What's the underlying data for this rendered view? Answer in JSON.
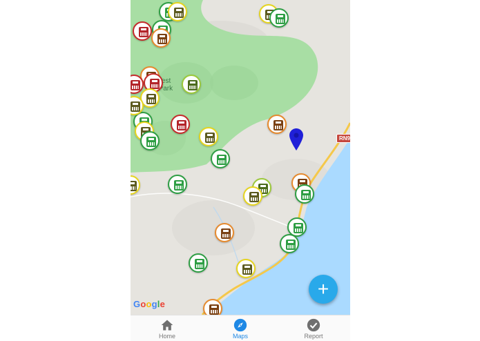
{
  "map": {
    "park_label": "Forest\nal Park",
    "road_shield": "RN9",
    "attribution": [
      "G",
      "o",
      "o",
      "g",
      "l",
      "e"
    ],
    "markers": [
      {
        "status": "yellow"
      },
      {
        "status": "green"
      },
      {
        "status": "green"
      },
      {
        "status": "yellow"
      },
      {
        "status": "green"
      },
      {
        "status": "red"
      },
      {
        "status": "orange"
      },
      {
        "status": "orange"
      },
      {
        "status": "red"
      },
      {
        "status": "yellow"
      },
      {
        "status": "red"
      },
      {
        "status": "lime"
      },
      {
        "status": "yellow"
      },
      {
        "status": "green"
      },
      {
        "status": "red"
      },
      {
        "status": "orange"
      },
      {
        "status": "yellow"
      },
      {
        "status": "green"
      },
      {
        "status": "yellow"
      },
      {
        "status": "green"
      },
      {
        "status": "green"
      },
      {
        "status": "lime"
      },
      {
        "status": "yellow"
      },
      {
        "status": "orange"
      },
      {
        "status": "green"
      },
      {
        "status": "yellow"
      },
      {
        "status": "green"
      },
      {
        "status": "green"
      },
      {
        "status": "orange"
      },
      {
        "status": "green"
      },
      {
        "status": "yellow"
      },
      {
        "status": "orange"
      }
    ]
  },
  "fab": {
    "label": "+",
    "icon": "plus-icon"
  },
  "nav": {
    "items": [
      {
        "label": "Home",
        "icon": "home-icon",
        "active": false
      },
      {
        "label": "Maps",
        "icon": "compass-icon",
        "active": true
      },
      {
        "label": "Report",
        "icon": "check-circle-icon",
        "active": false
      }
    ]
  },
  "colors": {
    "accent": "#1e88e5",
    "fab": "#29a9ea",
    "pin": "#2020d8",
    "green": "#2e9e44",
    "yellow": "#e6d51f",
    "orange": "#e68a2e",
    "red": "#c52b2b",
    "lime": "#9cc93a",
    "water": "#aadaff",
    "park": "#a8e0a0",
    "land": "#e8e6e2"
  }
}
